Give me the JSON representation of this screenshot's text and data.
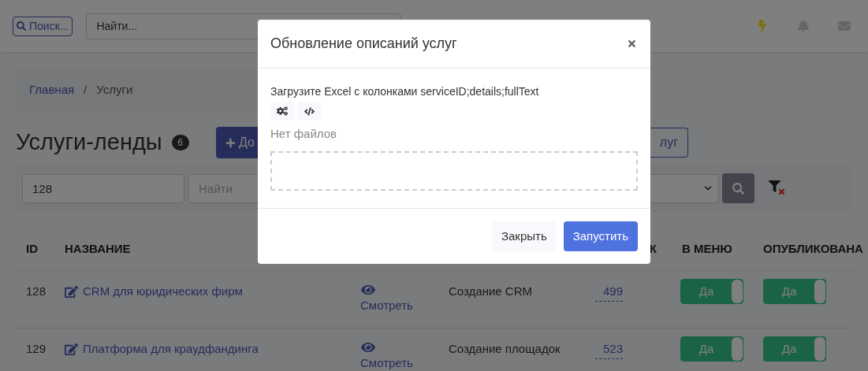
{
  "topbar": {
    "search_button": "Поиск...",
    "search_field": {
      "placeholder": "Найти..."
    }
  },
  "breadcrumb": {
    "items": [
      {
        "label": "Главная",
        "kind": "link"
      },
      {
        "label": "Услуги",
        "kind": "current"
      }
    ],
    "separator": "/"
  },
  "page": {
    "title": "Услуги-ленды",
    "count": "6",
    "add_button": "До",
    "other_button": "луг"
  },
  "filters": {
    "id_field": {
      "value": "128"
    },
    "name_field": {
      "placeholder": "Найти"
    }
  },
  "table": {
    "columns": {
      "id": "ID",
      "name": "НАЗВАНИЕ",
      "column_5": "К",
      "in_menu": "В МЕНЮ",
      "published": "ОПУБЛИКОВАНА"
    },
    "rows": [
      {
        "id": "128",
        "name": "CRM для юридических фирм",
        "view": "Смотреть",
        "category": "Создание CRM",
        "number": "499",
        "in_menu": {
          "label": "Да",
          "on": true
        },
        "published": {
          "label": "Да",
          "on": true
        }
      },
      {
        "id": "129",
        "name": "Платформа для краудфандинга",
        "view": "Смотреть",
        "category": "Создание площадок",
        "number": "523",
        "in_menu": {
          "label": "Да",
          "on": true
        },
        "published": {
          "label": "Да",
          "on": true
        }
      }
    ]
  },
  "modal": {
    "title": "Обновление описаний услуг",
    "instruction": "Загрузите Excel с колонками serviceID;details;fullText",
    "no_files": "Нет файлов",
    "buttons": [
      {
        "label": "Закрыть",
        "kind": "secondary"
      },
      {
        "label": "Запустить",
        "kind": "primary"
      }
    ]
  }
}
